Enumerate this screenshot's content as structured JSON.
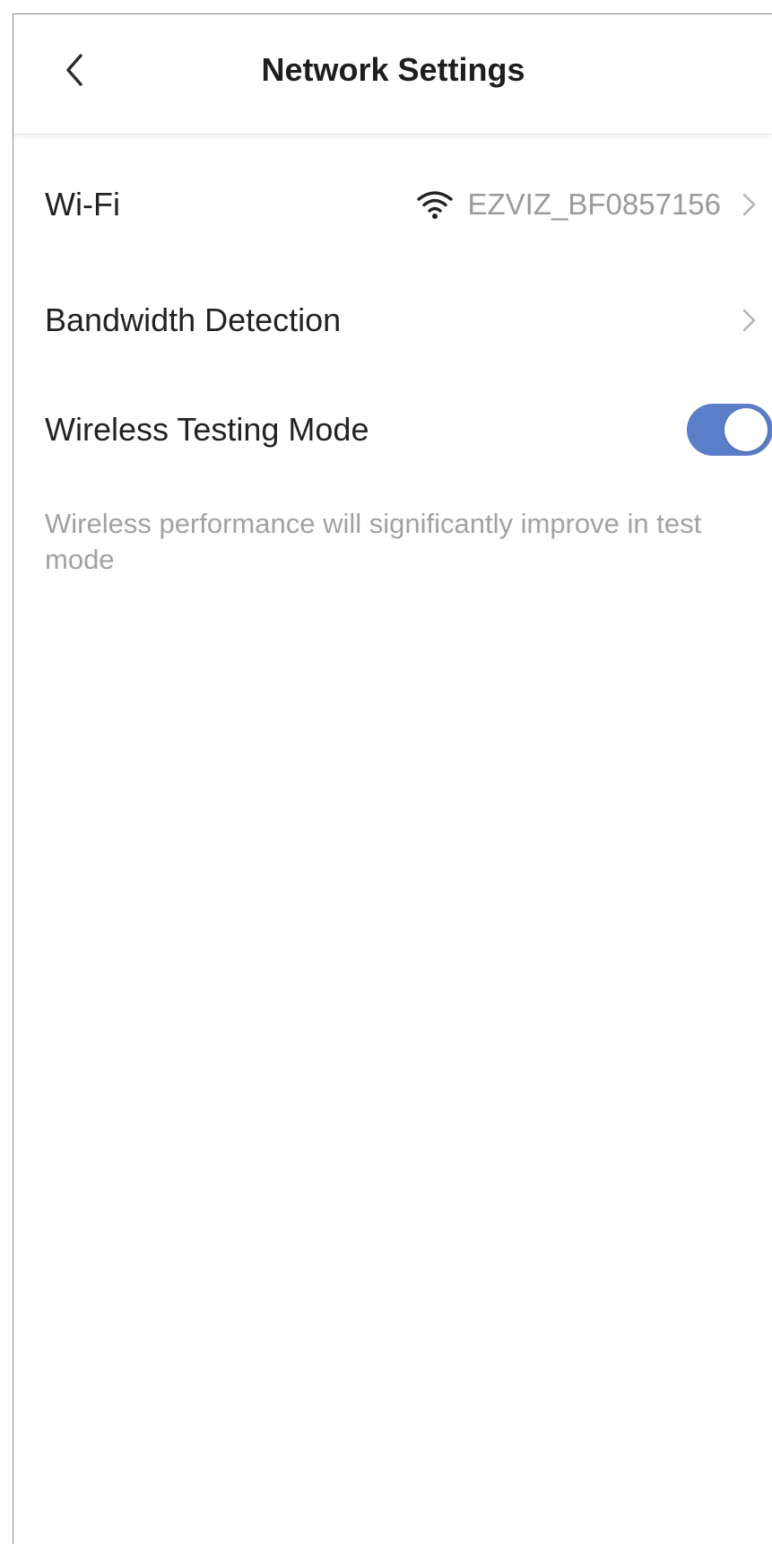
{
  "header": {
    "title": "Network Settings",
    "back_icon": "chevron-left-icon"
  },
  "wifi": {
    "label": "Wi-Fi",
    "icon": "wifi-icon",
    "value": "EZVIZ_BF0857156"
  },
  "bandwidth": {
    "label": "Bandwidth Detection"
  },
  "wireless_testing": {
    "label": "Wireless Testing Mode",
    "enabled": true,
    "hint": "Wireless performance will significantly improve in test mode"
  },
  "colors": {
    "toggle_on": "#5b7ec9",
    "secondary_text": "#9a9a9a"
  }
}
